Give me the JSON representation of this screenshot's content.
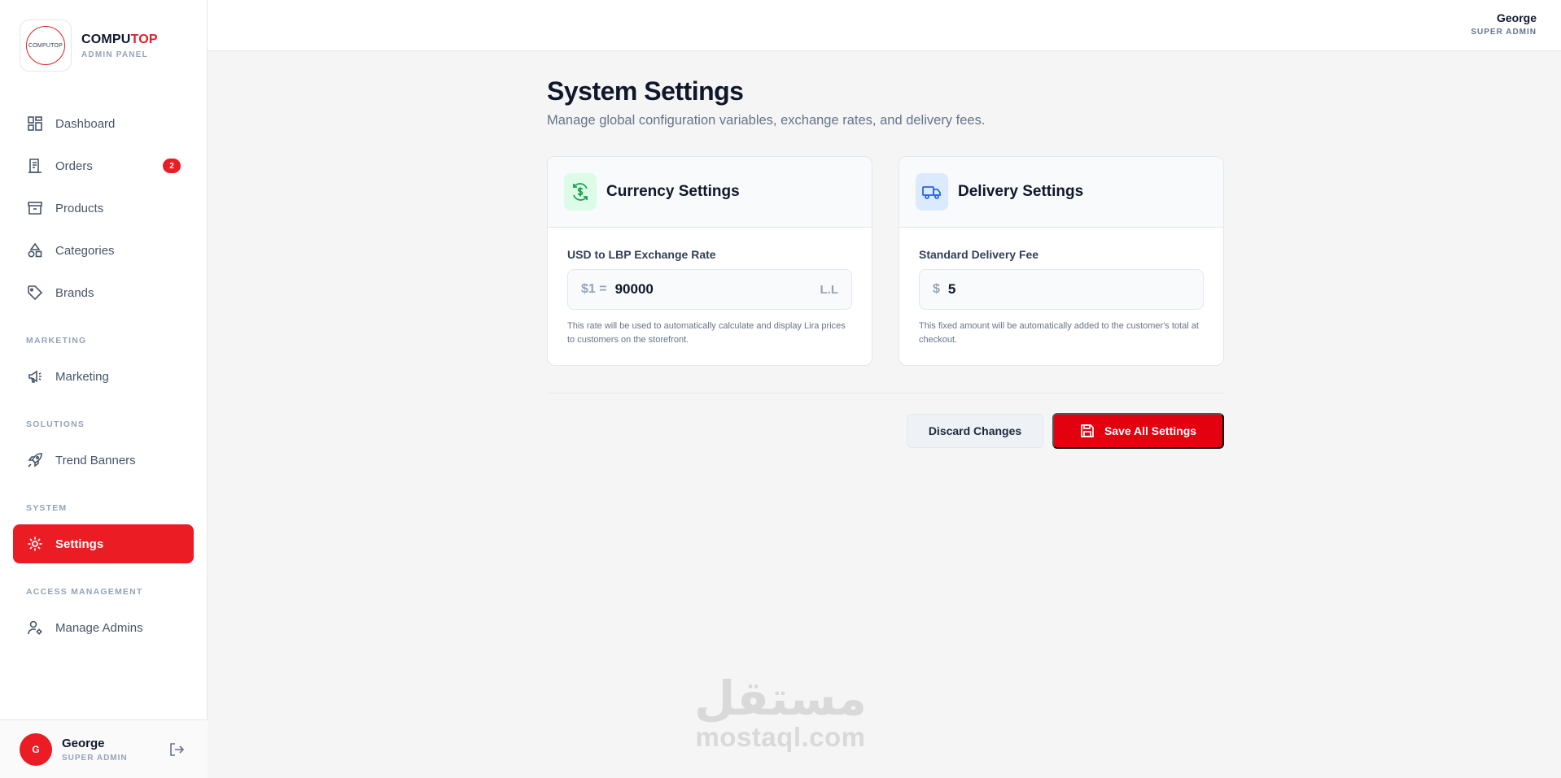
{
  "brand": {
    "name_part1": "COMPU",
    "name_part2": "TOP",
    "subtitle": "ADMIN PANEL",
    "logo_text": "COMPUTOP"
  },
  "sidebar": {
    "items": [
      {
        "label": "Dashboard",
        "icon": "dashboard-icon"
      },
      {
        "label": "Orders",
        "icon": "orders-icon",
        "badge": "2"
      },
      {
        "label": "Products",
        "icon": "archive-icon"
      },
      {
        "label": "Categories",
        "icon": "shapes-icon"
      },
      {
        "label": "Brands",
        "icon": "tag-icon"
      }
    ],
    "sections": [
      {
        "label": "MARKETING",
        "items": [
          {
            "label": "Marketing",
            "icon": "megaphone-icon"
          }
        ]
      },
      {
        "label": "SOLUTIONS",
        "items": [
          {
            "label": "Trend Banners",
            "icon": "rocket-icon"
          }
        ]
      },
      {
        "label": "SYSTEM",
        "items": [
          {
            "label": "Settings",
            "icon": "gear-icon",
            "active": true
          }
        ]
      },
      {
        "label": "ACCESS MANAGEMENT",
        "items": [
          {
            "label": "Manage Admins",
            "icon": "user-gear-icon"
          }
        ]
      }
    ],
    "user": {
      "initial": "G",
      "name": "George",
      "role": "SUPER ADMIN"
    }
  },
  "topbar": {
    "user_name": "George",
    "user_role": "SUPER ADMIN"
  },
  "main": {
    "title": "System Settings",
    "subtitle": "Manage global configuration variables, exchange rates, and delivery fees.",
    "currency_card": {
      "title": "Currency Settings",
      "field_label": "USD to LBP Exchange Rate",
      "prefix": "$1 =",
      "value": "90000",
      "suffix": "L.L",
      "hint": "This rate will be used to automatically calculate and display Lira prices to customers on the storefront."
    },
    "delivery_card": {
      "title": "Delivery Settings",
      "field_label": "Standard Delivery Fee",
      "prefix": "$",
      "value": "5",
      "hint": "This fixed amount will be automatically added to the customer's total at checkout."
    },
    "discard_label": "Discard Changes",
    "save_label": "Save All Settings"
  },
  "watermark": {
    "arabic": "مستقل",
    "latin": "mostaql.com"
  },
  "colors": {
    "accent": "#ec1c24",
    "save_button": "#e3000f",
    "currency_icon_bg": "#dcfce7",
    "delivery_icon_bg": "#dbeafe"
  }
}
